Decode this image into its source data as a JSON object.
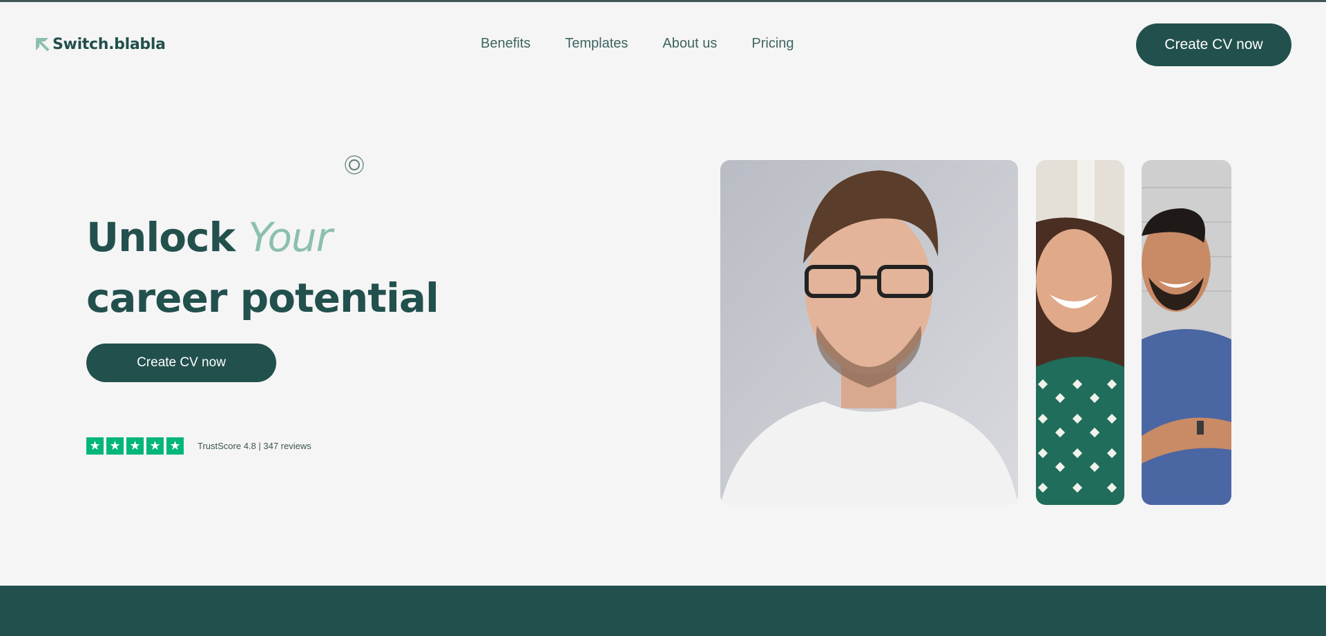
{
  "header": {
    "logo_text": "Switch.blabla",
    "logo_icon": "arrow-corner-icon",
    "nav": [
      {
        "label": "Benefits"
      },
      {
        "label": "Templates"
      },
      {
        "label": "About us"
      },
      {
        "label": "Pricing"
      }
    ],
    "cta_label": "Create CV now"
  },
  "hero": {
    "title_word1": "Unlock",
    "title_accent": "Your",
    "title_line2": "career potential",
    "cta_label": "Create CV now",
    "decor_icon": "target-icon",
    "rating": {
      "stars": 5,
      "text": "TrustScore 4.8 | 347 reviews"
    }
  },
  "photos": [
    {
      "name": "man-with-glasses-photo"
    },
    {
      "name": "smiling-woman-photo"
    },
    {
      "name": "smiling-man-photo"
    }
  ],
  "colors": {
    "brand": "#22504d",
    "accent": "#8bbfae",
    "background": "#f5f5f5",
    "star": "#00b67a"
  }
}
